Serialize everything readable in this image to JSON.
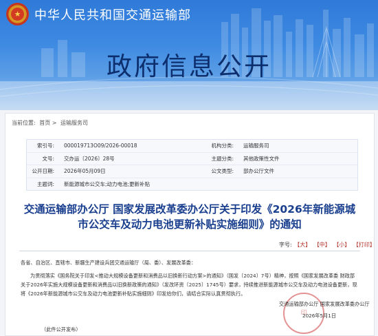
{
  "site": {
    "ministry_name": "中华人民共和国交通运输部",
    "banner_title": "政府信息公开",
    "emblem_glyph": "★"
  },
  "breadcrumb": {
    "label": "当前位置:",
    "sep": ">",
    "home": "首页",
    "section": "运输服务司"
  },
  "meta": {
    "index_label": "索引号:",
    "index_value": "000019713O09/2026-00018",
    "org_label": "机构分类:",
    "org_value": "运输服务司",
    "docno_label": "文号:",
    "docno_value": "交办运〔2026〕28号",
    "topic_label": "主题分类:",
    "topic_value": "其他政策性文件",
    "date_label": "公开日期:",
    "date_value": "2026年05月09日",
    "type_label": "公文类型:",
    "type_value": "部办公厅文件",
    "keywords_label": "主题词:",
    "keywords_value": "新能源城市公交车;动力电池;更新补贴"
  },
  "document": {
    "title": "交通运输部办公厅 国家发展改革委办公厅关于印发《2026年新能源城市公交车及动力电池更新补贴实施细则》的通知",
    "font_size_label": "字号:",
    "font_large": "【大】",
    "font_medium": "【中】",
    "font_small": "【小】",
    "print": "【打印】",
    "salutation": "各省、自治区、直辖市、新疆生产建设兵团交通运输厅（局、委）、发展改革委：",
    "paragraph": "为贯彻落实《国务院关于印发<推动大规模设备更新和消费品以旧换新行动方案>的通知》（国发〔2024〕7号）精神，按照《国家发展改革委 财政部关于2026年实施大规模设备更新和消费品以旧换新政策的通知》（发改环资〔2025〕1745号）要求，持续推进新能源城市公交车及动力电池设备更新，现将《2026年新能源城市公交车及动力电池更新补贴实施细则》印发给你们，请结合实际认真贯彻执行。",
    "signature": "交通运输部办公厅  国家发展改革委办公厅",
    "sign_date": "2026年5月1日",
    "publish_note": "（此件公开发布）",
    "stamp_text": "印"
  }
}
